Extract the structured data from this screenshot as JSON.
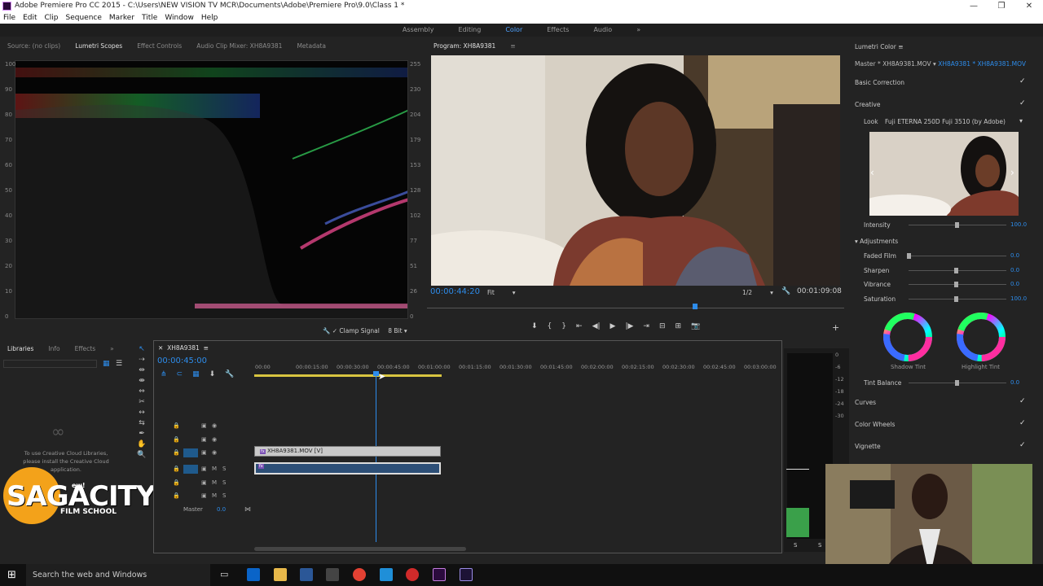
{
  "window": {
    "title": "Adobe Premiere Pro CC 2015 - C:\\Users\\NEW VISION TV MCR\\Documents\\Adobe\\Premiere Pro\\9.0\\Class 1 *"
  },
  "menu": [
    "File",
    "Edit",
    "Clip",
    "Sequence",
    "Marker",
    "Title",
    "Window",
    "Help"
  ],
  "workspaces": [
    "Assembly",
    "Editing",
    "Color",
    "Effects",
    "Audio"
  ],
  "active_workspace": "Color",
  "source_panel": {
    "tabs": [
      "Source: (no clips)",
      "Lumetri Scopes",
      "Effect Controls",
      "Audio Clip Mixer: XH8A9381",
      "Metadata"
    ],
    "active": "Lumetri Scopes",
    "left_scale": [
      "100",
      "90",
      "80",
      "70",
      "60",
      "50",
      "40",
      "30",
      "20",
      "10",
      "0"
    ],
    "right_scale": [
      "255",
      "230",
      "204",
      "179",
      "153",
      "128",
      "102",
      "77",
      "51",
      "26",
      "0"
    ],
    "clamp_signal": "Clamp Signal",
    "bit_depth": "8 Bit"
  },
  "program": {
    "title": "Program: XH8A9381",
    "timecode": "00:00:44:20",
    "fit": "Fit",
    "resolution": "1/2",
    "duration": "00:01:09:08"
  },
  "lumetri": {
    "title": "Lumetri Color",
    "master": "Master * XH8A9381.MOV",
    "clip": "XH8A9381 * XH8A9381.MOV",
    "basic_correction": "Basic Correction",
    "creative": "Creative",
    "look_label": "Look",
    "look_value": "Fuji ETERNA 250D Fuji 3510 (by Adobe)",
    "intensity_label": "Intensity",
    "intensity_value": "100.0",
    "adjustments": "Adjustments",
    "sliders": [
      {
        "label": "Faded Film",
        "value": "0.0",
        "level": 0
      },
      {
        "label": "Sharpen",
        "value": "0.0",
        "level": 0.5
      },
      {
        "label": "Vibrance",
        "value": "0.0",
        "level": 0.5
      },
      {
        "label": "Saturation",
        "value": "100.0",
        "level": 0.5
      }
    ],
    "shadow_tint": "Shadow Tint",
    "highlight_tint": "Highlight Tint",
    "tint_balance_label": "Tint Balance",
    "tint_balance_value": "0.0",
    "curves": "Curves",
    "color_wheels": "Color Wheels",
    "vignette": "Vignette"
  },
  "libraries": {
    "tabs": [
      "Libraries",
      "Info",
      "Effects"
    ],
    "message": "To use Creative Cloud Libraries, please install the Creative Cloud application.",
    "brand": "SAGACITY",
    "brand_sub": "FILM SCHOOL",
    "new": "ew!"
  },
  "timeline": {
    "sequence": "XH8A9381",
    "timecode": "00:00:45:00",
    "ruler": [
      "00:00",
      "00:00:15:00",
      "00:00:30:00",
      "00:00:45:00",
      "00:01:00:00",
      "00:01:15:00",
      "00:01:30:00",
      "00:01:45:00",
      "00:02:00:00",
      "00:02:15:00",
      "00:02:30:00",
      "00:02:45:00",
      "00:03:00:00"
    ],
    "video_tracks": [
      "V3",
      "V2",
      "V1"
    ],
    "audio_tracks": [
      "A1",
      "A2",
      "A3"
    ],
    "master": "Master",
    "master_value": "0.0",
    "clip_name": "XH8A9381.MOV [V]"
  },
  "meter": {
    "scale": [
      "0",
      "-6",
      "-12",
      "-18",
      "-24",
      "-30"
    ],
    "labels": [
      "S",
      "S"
    ]
  },
  "taskbar": {
    "search": "Search the web and Windows"
  }
}
